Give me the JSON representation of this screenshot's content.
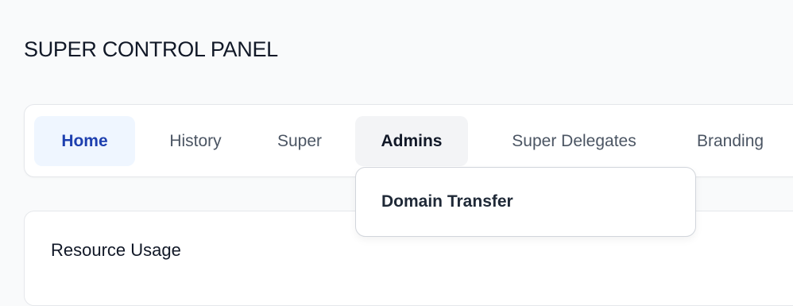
{
  "header": {
    "title": "SUPER CONTROL PANEL"
  },
  "nav": {
    "tabs": [
      {
        "label": "Home",
        "state": "active"
      },
      {
        "label": "History",
        "state": "default"
      },
      {
        "label": "Super",
        "state": "default"
      },
      {
        "label": "Admins",
        "state": "open"
      },
      {
        "label": "Super Delegates",
        "state": "default"
      },
      {
        "label": "Branding",
        "state": "default"
      }
    ]
  },
  "admins_menu": {
    "items": [
      {
        "label": "Domain Transfer"
      }
    ]
  },
  "main": {
    "section_title": "Resource Usage"
  },
  "colors": {
    "active_tab_bg": "#eff6ff",
    "active_tab_text": "#1e40af",
    "page_bg": "#f9fafb"
  }
}
